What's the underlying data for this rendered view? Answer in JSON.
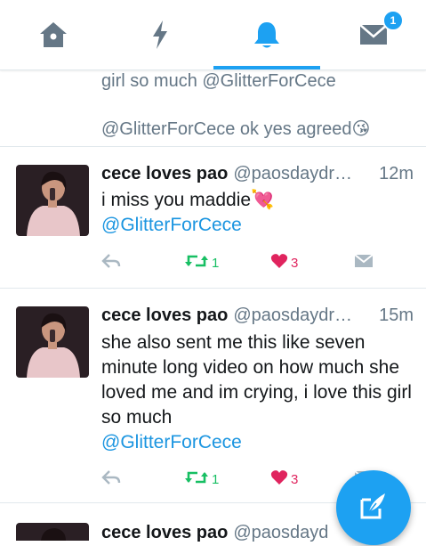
{
  "nav": {
    "tabs": [
      {
        "name": "home",
        "icon": "home-icon"
      },
      {
        "name": "moments",
        "icon": "lightning-icon"
      },
      {
        "name": "notifications",
        "icon": "bell-icon",
        "active": true
      },
      {
        "name": "messages",
        "icon": "envelope-icon",
        "badge": "1"
      }
    ],
    "accent": "#1da1f2"
  },
  "feed": {
    "previous_tail": {
      "line1": "girl so much @GlitterForCece",
      "line2": "@GlitterForCece ok yes agreed😘"
    },
    "tweets": [
      {
        "name": "cece loves pao",
        "handle": "@paosdaydr…",
        "time": "12m",
        "text": "i miss you maddie💘",
        "mention": "@GlitterForCece",
        "retweets": "1",
        "likes": "3"
      },
      {
        "name": "cece loves pao",
        "handle": "@paosdaydr…",
        "time": "15m",
        "text": "she also sent me this like seven minute long video on how much she loved me and im crying, i love this girl so much",
        "mention": "@GlitterForCece",
        "retweets": "1",
        "likes": "3"
      },
      {
        "name": "cece loves pao",
        "handle": "@paosdayd",
        "time": "",
        "text": "",
        "mention": "",
        "retweets": "",
        "likes": ""
      }
    ]
  },
  "fab": {
    "icon": "compose-tweet-icon"
  },
  "colors": {
    "retweet": "#17bf63",
    "like": "#e0245e",
    "muted": "#657786",
    "link": "#1b95e0"
  }
}
